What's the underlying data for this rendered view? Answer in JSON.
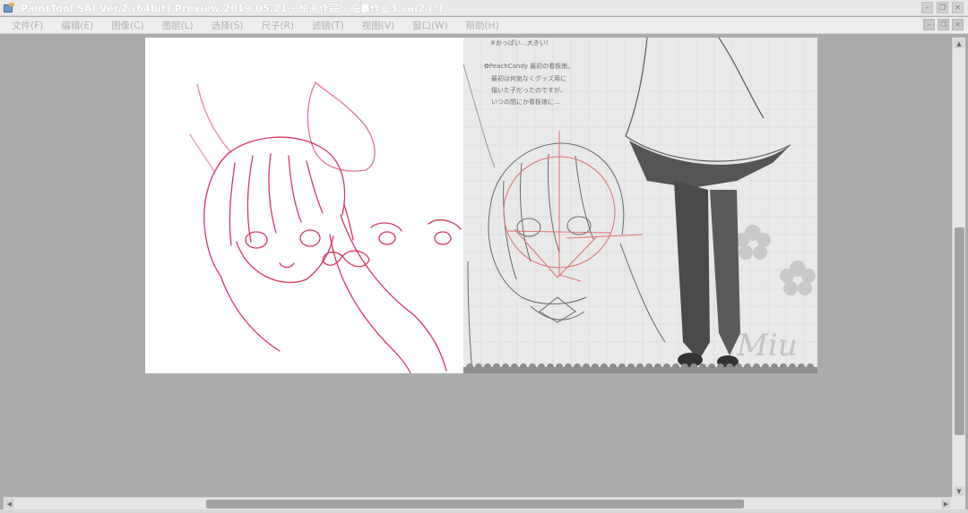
{
  "window": {
    "title": "PaintTool SAI Ver.2 (64bit) Preview.2019.05.21 - 绘画作品 / 临摹作业3.sai2 (*)",
    "controls": {
      "minimize": "–",
      "restore": "❐",
      "close": "✕"
    }
  },
  "menu": {
    "items": [
      {
        "label": "文件(F)"
      },
      {
        "label": "编辑(E)"
      },
      {
        "label": "图像(C)"
      },
      {
        "label": "图层(L)"
      },
      {
        "label": "选择(S)"
      },
      {
        "label": "尺子(R)"
      },
      {
        "label": "滤镜(T)"
      },
      {
        "label": "视图(V)"
      },
      {
        "label": "窗口(W)"
      },
      {
        "label": "帮助(H)"
      }
    ]
  },
  "document_controls": {
    "minimize": "–",
    "restore": "❐",
    "close": "✕"
  },
  "canvas": {
    "reference_text": {
      "line1": "※おっぱい…大きい!",
      "line2": "✿PeachCandy 最初の看板娘。",
      "line3": "最初は何気なくグッズ用に",
      "line4": "描いた子だったのですが、",
      "line5": "いつの間にか看板娘に…",
      "signature": "Miu"
    }
  },
  "scrollbars": {
    "vertical": {
      "position": 0.5
    },
    "horizontal": {
      "position": 0.5
    }
  },
  "colors": {
    "sketch": "#d8375a",
    "guide": "#e07070",
    "workspace": "#ababab",
    "menu_text": "#b2b2b2"
  }
}
